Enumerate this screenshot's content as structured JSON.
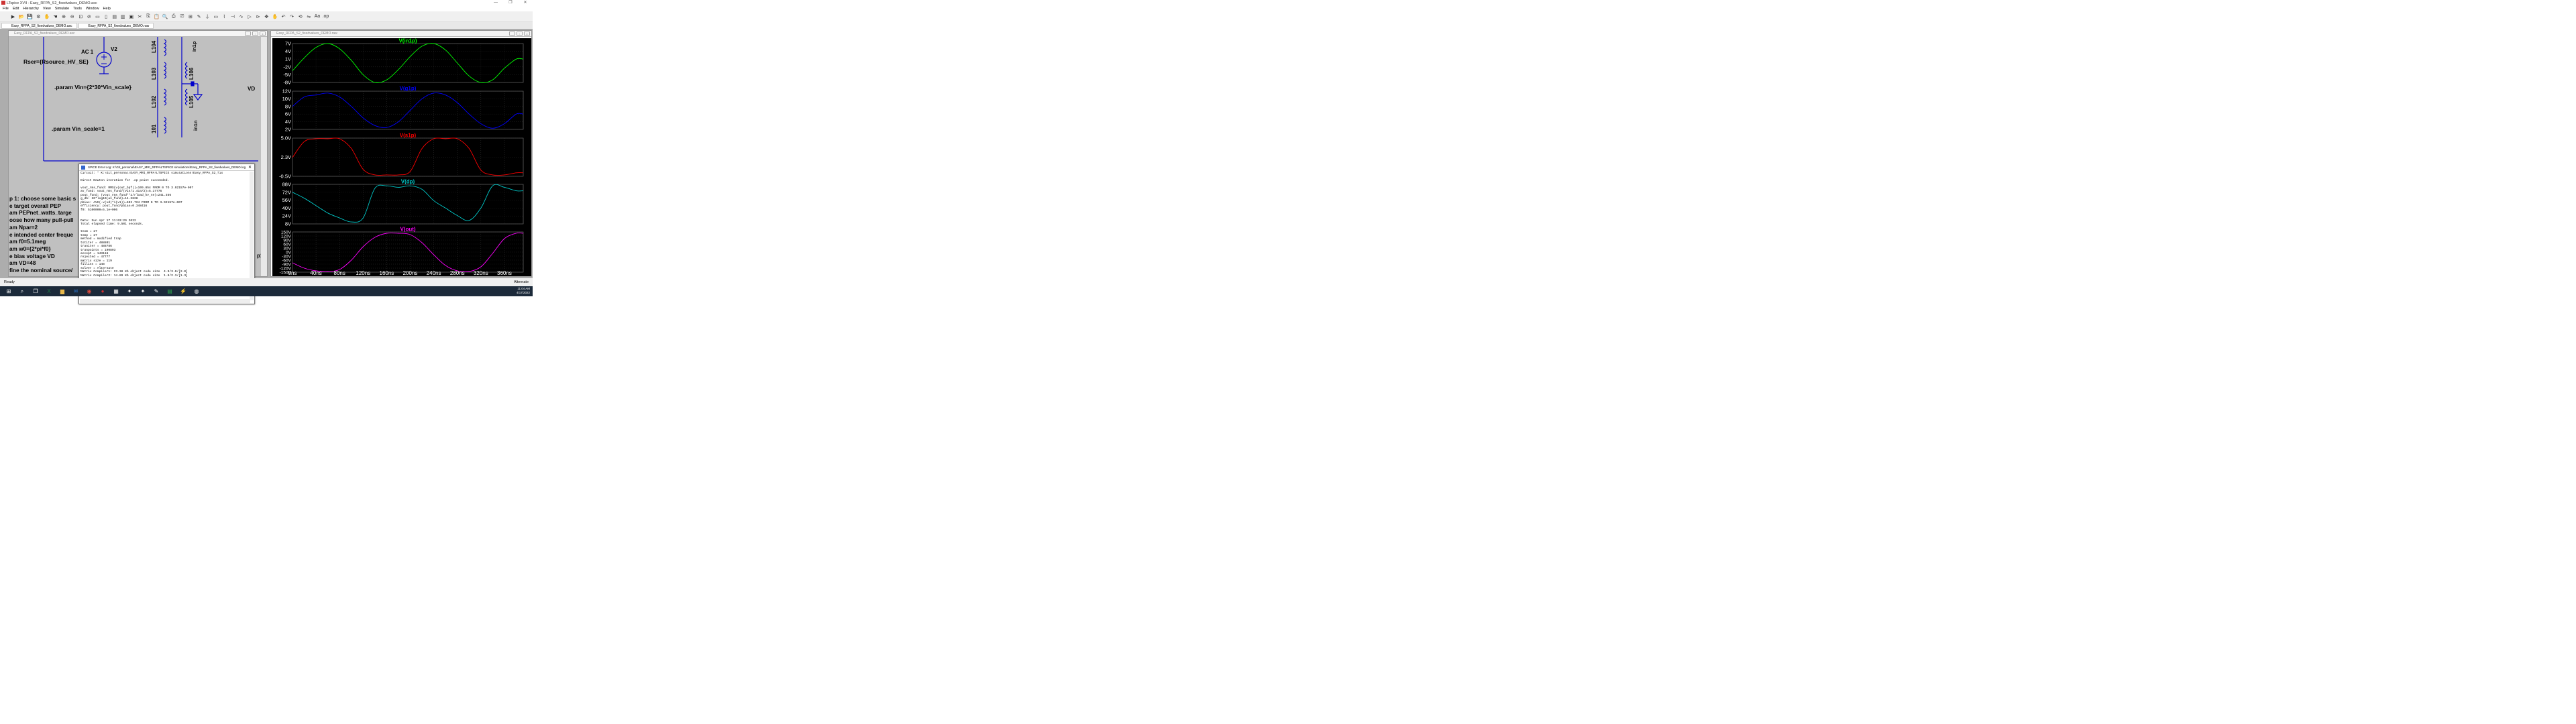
{
  "app": {
    "title": "LTspice XVII - Easy_RFPA_S2_fixedvalues_DEMO.asc",
    "window_controls": [
      "—",
      "❐",
      "✕"
    ]
  },
  "menu": [
    "File",
    "Edit",
    "Hierarchy",
    "View",
    "Simulate",
    "Tools",
    "Window",
    "Help"
  ],
  "toolbar_icons": [
    "run-icon",
    "open-icon",
    "save-icon",
    "settings-icon",
    "halt-icon",
    "hand-icon",
    "zoom-in-icon",
    "zoom-out-icon",
    "zoom-fit-icon",
    "zoom-cancel-icon",
    "dc-icon",
    "ac-icon",
    "tile-horizontal-icon",
    "tile-vertical-icon",
    "close-icon",
    "cut-icon",
    "copy-icon",
    "paste-icon",
    "find-icon",
    "print-icon",
    "print-preview-icon",
    "setup-icon",
    "pencil-icon",
    "ground-icon",
    "label-icon",
    "resistor-icon",
    "capacitor-icon",
    "inductor-icon",
    "diode-icon",
    "component-icon",
    "move-icon",
    "drag-icon",
    "undo-icon",
    "redo-icon",
    "rotate-icon",
    "mirror-icon",
    "text-icon",
    "spice-directive-icon"
  ],
  "tabs": [
    {
      "label": "Easy_RFPA_S2_fixedvalues_DEMO.asc"
    },
    {
      "label": "Easy_RFPA_S2_fixedvalues_DEMO.raw"
    }
  ],
  "schematic": {
    "window_title": "Easy_RFPA_S2_fixedvalues_DEMO.asc",
    "texts": {
      "ac": "AC 1",
      "v2": "V2",
      "rser": "Rser={Rsource_HV_SE}",
      "param_vin": ".param Vin={2*30*Vin_scale}",
      "param_vin_scale": ".param Vin_scale=1",
      "vd": "VD",
      "l104": "L104",
      "l103": "L103",
      "l102": "L102",
      "l101": "101",
      "l106": "L106",
      "l105": "L105",
      "in1p": "in1p",
      "in1n": "in1n",
      "op1p": "p1p"
    },
    "comment_lines": [
      "p 1: choose some basic s",
      "e target overall PEP",
      "am PEPnet_watts_targe",
      "oose how many pull-pull",
      "am Npar=2",
      "e intended center freque",
      "am f0=5.1meg",
      "am w0={2*pi*f0}",
      "e bias voltage VD",
      "am VD=48",
      "fine the nominal source/"
    ]
  },
  "error_log": {
    "title": "SPICE Error Log: K:\\Git_personal\\EASY_MRI_RFPA\\LTSPICE simulations\\Easy_RFPA_S2_fixedvalues_DEMO.log",
    "lines": [
      "Circuit: * K:\\Git_personal\\EASY_MRI_RFPA\\LTSPICE simulations\\Easy_RFPA_S2_fix",
      "",
      "Direct Newton iteration for .op point succeeded.",
      "",
      "vout_rms_fund: RMS(v(out_bpf))=109.854 FROM 0 TO 3.92157e-007",
      "av_fund: vout_rms_fund/(Vin/1.414/2)=5.17776",
      "pout_fund: (vout_rms_fund**2/rload_hv_se)=241.356",
      "g_db: 20*log10(av_fund)=14.2828",
      "pbias: AVG(-v(vd)*i(v1))=692.724 FROM 0 TO 3.92157e-007",
      "efficiency: pout_fund/pbias=0.348416",
      "f0: 5100000=5.1e+006",
      "",
      "",
      "Date: Sun Apr 17 11:03:29 2022",
      "Total elapsed time: 9.501 seconds.",
      "",
      "tnom = 27",
      "temp = 27",
      "method = modified trap",
      "totiter = 488801",
      "traniter = 488786",
      "tranpoints = 190893",
      "accept = 143116",
      "rejected = 47777",
      "matrix size = 119",
      "fillins = 148",
      "solver = Alternate",
      "Matrix Compiler1: 23.38 Kb object code size  4.9/3.0/[2.0]",
      "Matrix Compiler2: 14.89 Kb object code size  1.8/2.3/[1.3]"
    ]
  },
  "waveform": {
    "window_title": "Easy_RFPA_S2_fixedvalues_DEMO.raw",
    "time_labels": [
      "0ns",
      "40ns",
      "80ns",
      "120ns",
      "160ns",
      "200ns",
      "240ns",
      "280ns",
      "320ns",
      "360ns"
    ],
    "panes": [
      {
        "name": "V(in1p)",
        "color": "#00ff00",
        "ticks": [
          "7V",
          "4V",
          "1V",
          "-2V",
          "-5V",
          "-8V"
        ]
      },
      {
        "name": "V(g1p)",
        "color": "#0000ff",
        "ticks": [
          "12V",
          "10V",
          "8V",
          "6V",
          "4V",
          "2V"
        ]
      },
      {
        "name": "V(s1p)",
        "color": "#ff0000",
        "ticks": [
          "5.0V",
          "2.3V",
          "-0.5V"
        ]
      },
      {
        "name": "V(dp)",
        "color": "#00c8c8",
        "ticks": [
          "88V",
          "72V",
          "56V",
          "40V",
          "24V",
          "8V"
        ]
      },
      {
        "name": "V(out)",
        "color": "#ff00ff",
        "ticks": [
          "150V",
          "120V",
          "90V",
          "60V",
          "30V",
          "0V",
          "-30V",
          "-60V",
          "-90V",
          "-120V",
          "-150V"
        ]
      }
    ]
  },
  "chart_data": {
    "type": "line",
    "x_unit": "ns",
    "x": [
      0,
      20,
      40,
      60,
      80,
      100,
      120,
      140,
      160,
      180,
      200,
      220,
      240,
      260,
      280,
      300,
      320,
      340,
      360,
      380
    ],
    "xlim": [
      0,
      392
    ],
    "series": [
      {
        "name": "V(in1p)",
        "ylim": [
          -8,
          7
        ],
        "values": [
          -3.5,
          1.5,
          5.5,
          7,
          5,
          0.5,
          -5,
          -8,
          -7,
          -3,
          2,
          6,
          7,
          4.5,
          -0.5,
          -5.5,
          -8,
          -7,
          -2.5,
          1
        ]
      },
      {
        "name": "V(g1p)",
        "ylim": [
          2,
          12
        ],
        "values": [
          8,
          10.5,
          11,
          11.5,
          10.5,
          8,
          5,
          3,
          2.5,
          4,
          7,
          10,
          11.5,
          11,
          9,
          6,
          3.5,
          2.3,
          3.5,
          6
        ]
      },
      {
        "name": "V(s1p)",
        "ylim": [
          -0.5,
          5
        ],
        "values": [
          2.2,
          4.5,
          4.9,
          4.9,
          4.9,
          3.5,
          0.5,
          -0.3,
          -0.3,
          -0.3,
          0.2,
          3.5,
          4.9,
          4.9,
          4.9,
          3.5,
          0.4,
          -0.3,
          -0.3,
          0
        ]
      },
      {
        "name": "V(dp)",
        "ylim": [
          8,
          88
        ],
        "values": [
          72,
          60,
          45,
          30,
          20,
          12,
          20,
          80,
          85,
          82,
          85,
          78,
          55,
          40,
          25,
          15,
          40,
          85,
          82,
          75
        ]
      },
      {
        "name": "V(out)",
        "ylim": [
          -150,
          150
        ],
        "values": [
          -80,
          -120,
          -140,
          -145,
          -130,
          -60,
          40,
          110,
          140,
          140,
          130,
          70,
          -20,
          -100,
          -140,
          -145,
          -110,
          -10,
          100,
          140
        ]
      }
    ]
  },
  "status": {
    "text": "Ready",
    "right": "Alternate"
  },
  "taskbar": {
    "icons": [
      "start-icon",
      "search-icon",
      "task-view-icon",
      "excel-icon",
      "explorer-icon",
      "mail-icon",
      "chrome-icon",
      "record-icon",
      "files-icon",
      "app-icon",
      "app-icon",
      "notepad-icon",
      "sheets-icon",
      "ltspice-icon",
      "browser-icon"
    ],
    "time": "11:04 AM",
    "date": "4/17/2022"
  }
}
